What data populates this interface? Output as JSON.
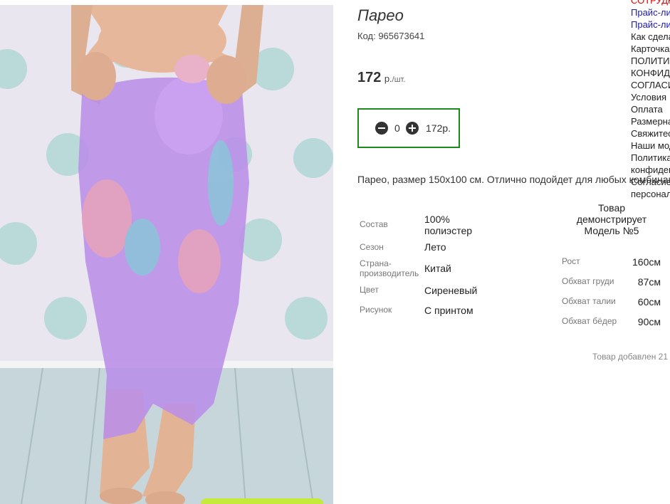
{
  "product": {
    "title": "Парео",
    "code": "Код: 965673641",
    "price_value": "172",
    "price_unit": "р.",
    "price_per": "/шт.",
    "quantity": "0",
    "quantity_sum": "172р.",
    "description": "Парео, размер 150х100 см. Отлично подойдет для любых комбинаций"
  },
  "attributes": [
    {
      "key": "Состав",
      "value": "100% полиэстер"
    },
    {
      "key": "Сезон",
      "value": "Лето"
    },
    {
      "key": "Страна-производитель",
      "value": "Китай"
    },
    {
      "key": "Цвет",
      "value": "Сиреневый"
    },
    {
      "key": "Рисунок",
      "value": "С принтом"
    }
  ],
  "model": {
    "title": "Товар демонстрирует Модель №5",
    "rows": [
      {
        "key": "Рост",
        "value": "160см"
      },
      {
        "key": "Обхват груди",
        "value": "87см"
      },
      {
        "key": "Обхват талии",
        "value": "60см"
      },
      {
        "key": "Обхват бёдер",
        "value": "90см"
      }
    ]
  },
  "added_text": "Товар добавлен 21",
  "side_menu": [
    {
      "label": "СОТРУДНИЧЕСТВО",
      "style": "red"
    },
    {
      "label": "Прайс-лист",
      "style": "blue"
    },
    {
      "label": "Прайс-лист",
      "style": "blue"
    },
    {
      "label": "Как сделать заказ",
      "style": "normal"
    },
    {
      "label": "Карточка",
      "style": "normal"
    },
    {
      "label": "ПОЛИТИКА",
      "style": "normal"
    },
    {
      "label": "КОНФИДЕНЦИАЛЬНОСТИ",
      "style": "normal"
    },
    {
      "label": "СОГЛАСИЕ",
      "style": "normal"
    },
    {
      "label": "Условия",
      "style": "normal"
    },
    {
      "label": "Оплата",
      "style": "normal"
    },
    {
      "label": "Размерная",
      "style": "normal"
    },
    {
      "label": "Свяжитесь",
      "style": "normal"
    },
    {
      "label": "Наши модели",
      "style": "normal"
    },
    {
      "label": "Политика",
      "style": "normal"
    },
    {
      "label": "конфиденциальности",
      "style": "normal"
    },
    {
      "label": "Согласие",
      "style": "normal"
    },
    {
      "label": "персональных",
      "style": "normal"
    }
  ],
  "icons": {
    "minus": "minus-circle-icon",
    "plus": "plus-circle-icon"
  },
  "colors": {
    "qty_border": "#1b8a1b",
    "menu_red": "#e00000",
    "menu_blue": "#1a1ab8",
    "fabric": "#b98ee8"
  }
}
